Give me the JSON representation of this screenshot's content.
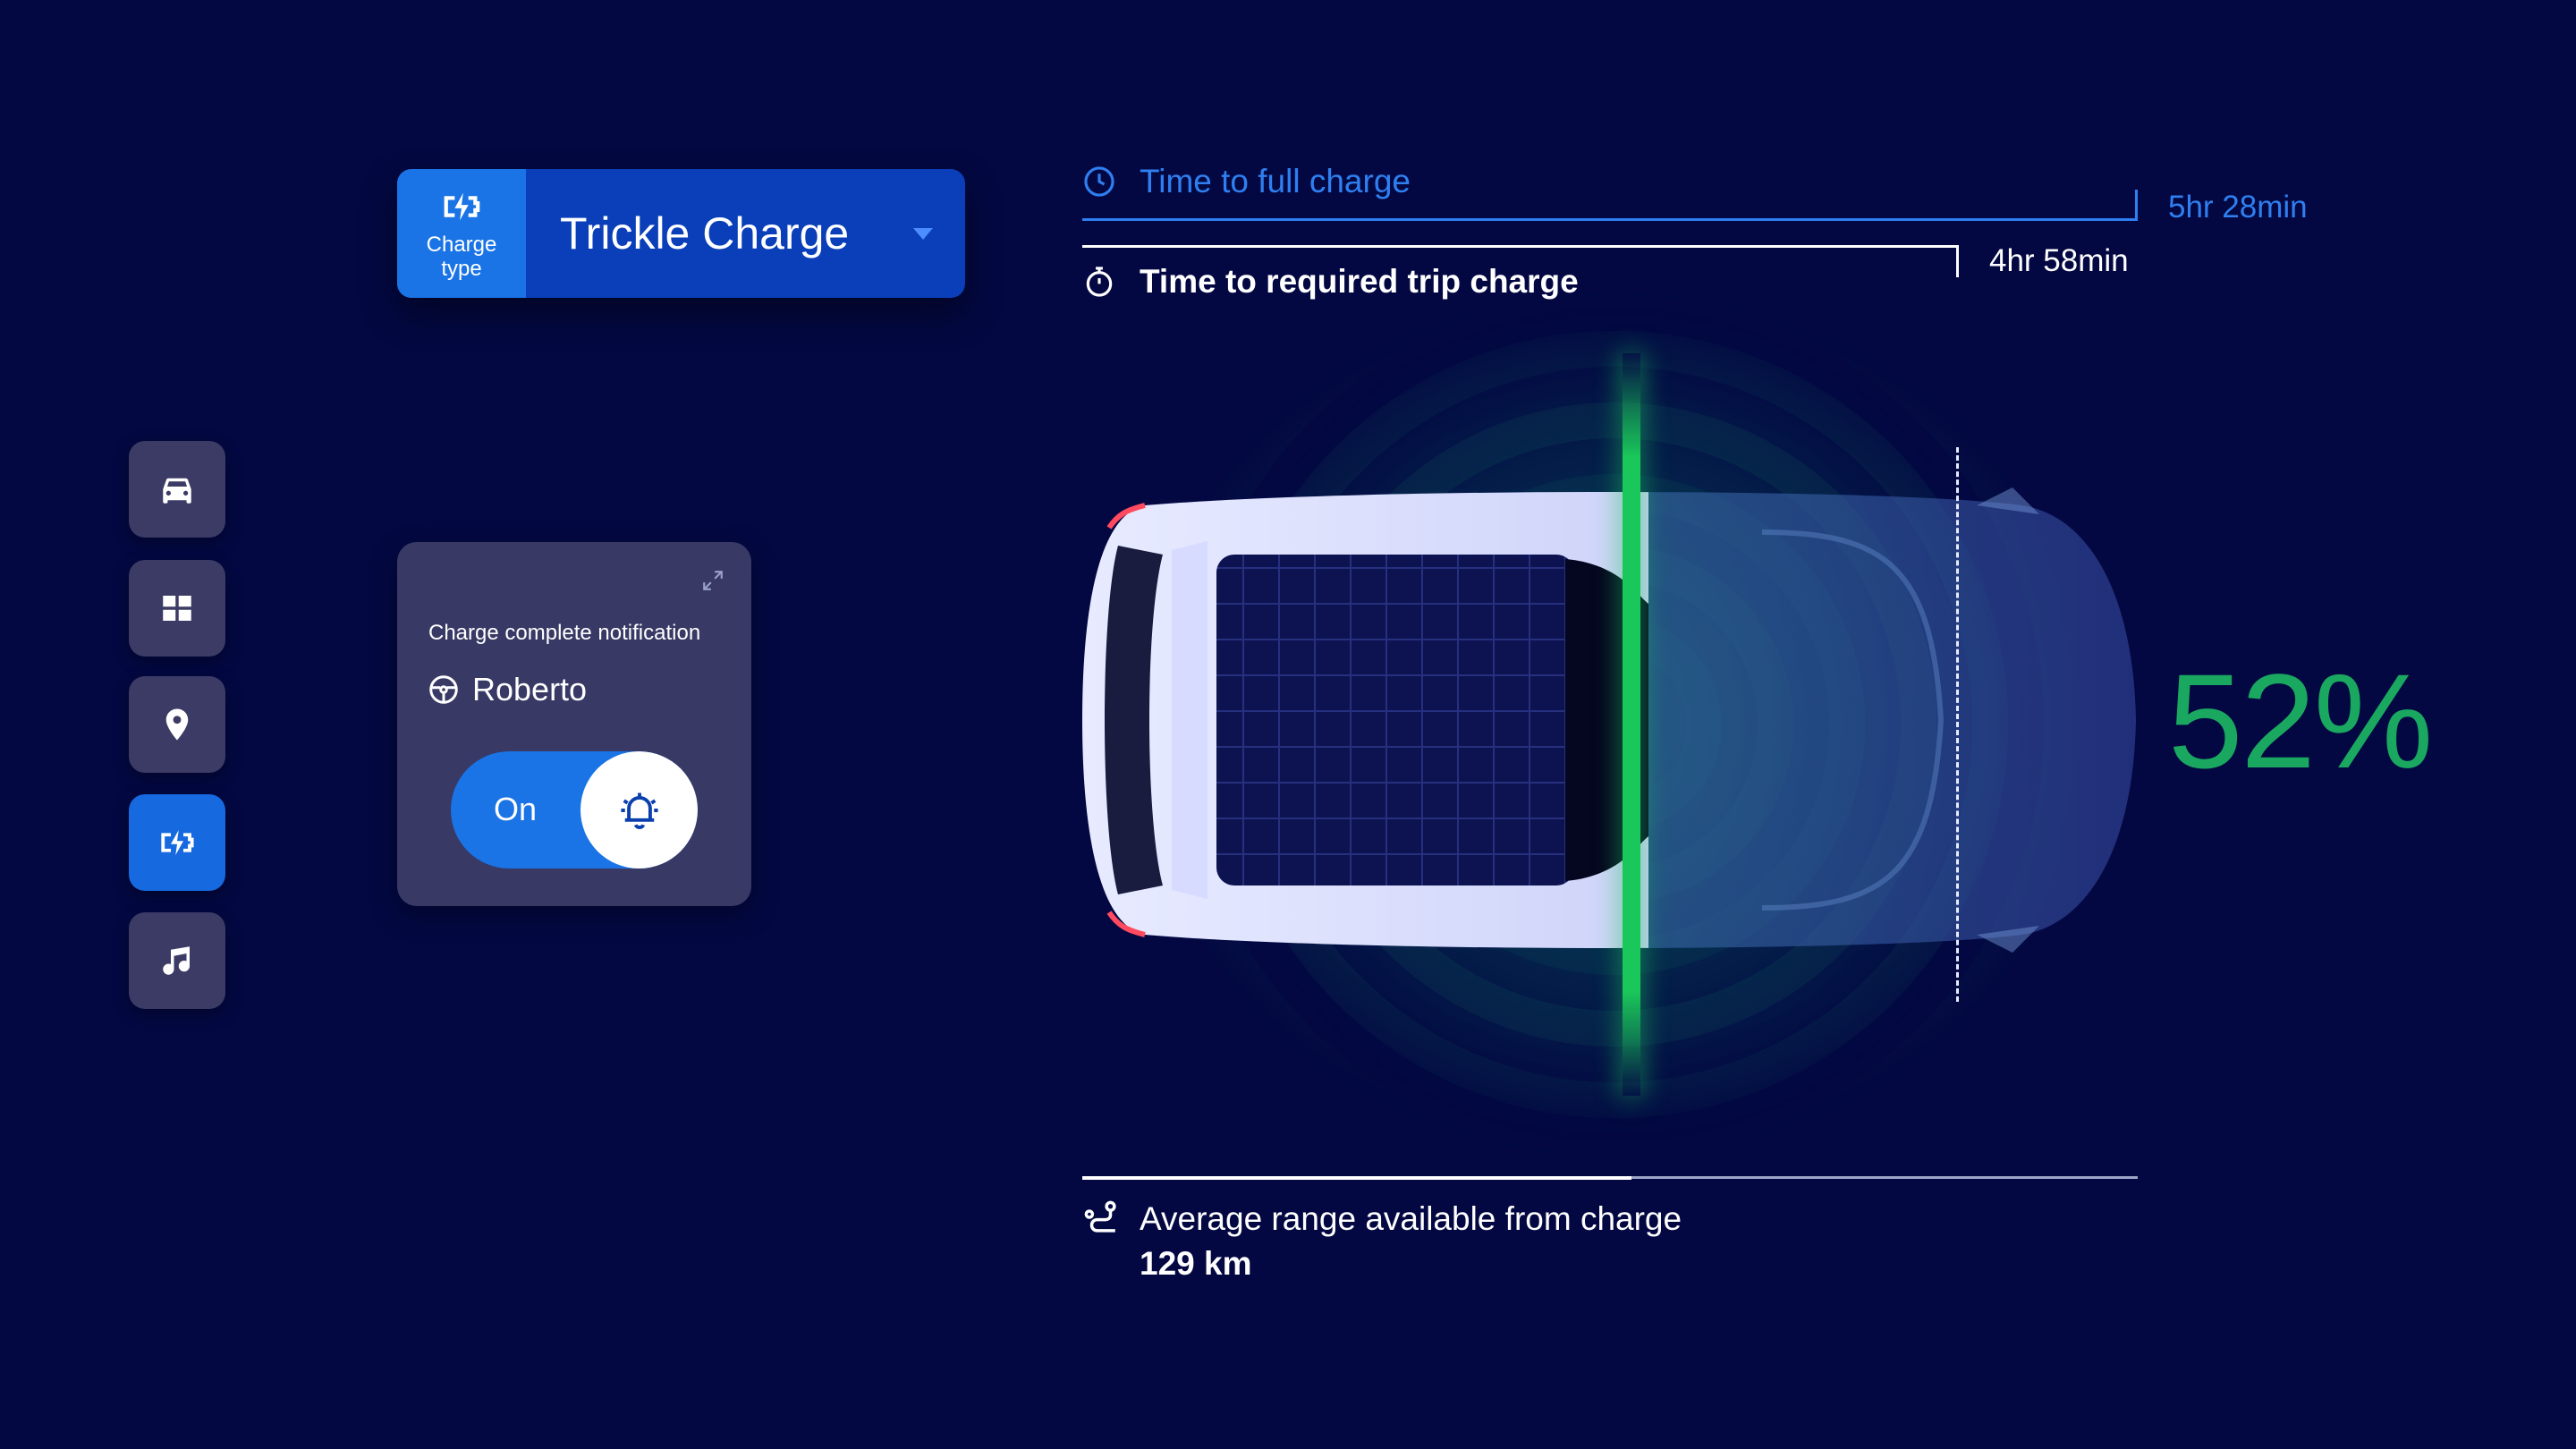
{
  "charge_type": {
    "label": "Charge type",
    "selected": "Trickle Charge"
  },
  "notification": {
    "title": "Charge complete notification",
    "user": "Roberto",
    "toggle_label": "On",
    "toggle_state": true
  },
  "times": {
    "full_charge_label": "Time to full charge",
    "full_charge_value": "5hr 28min",
    "trip_charge_label": "Time to required trip charge",
    "trip_charge_value": "4hr 58min"
  },
  "battery": {
    "percent_text": "52%",
    "level": 0.52
  },
  "range": {
    "label": "Average range available from charge",
    "value": "129 km"
  },
  "nav": [
    {
      "icon": "car-icon"
    },
    {
      "icon": "grid-icon"
    },
    {
      "icon": "location-pin-icon"
    },
    {
      "icon": "charging-icon",
      "active": true
    },
    {
      "icon": "music-note-icon"
    }
  ],
  "colors": {
    "background": "#030842",
    "accent_blue": "#1a74e6",
    "label_blue": "#2f7ff0",
    "charge_green": "#1ac75a",
    "percent_green": "#1aa860",
    "card": "#383965"
  }
}
